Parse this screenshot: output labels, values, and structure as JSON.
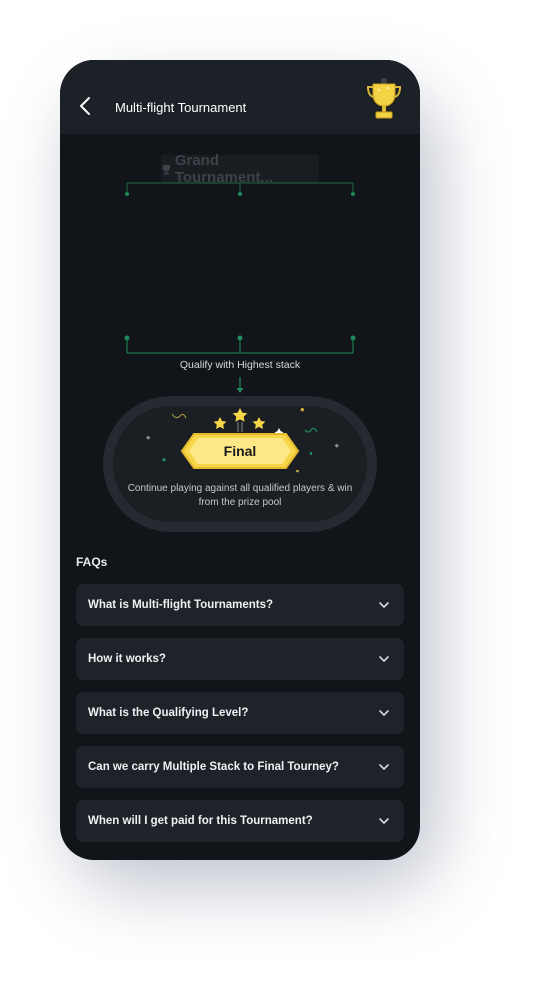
{
  "header": {
    "title": "Multi-flight Tournament",
    "trophy_icon": "trophy-icon",
    "back_icon": "chevron-left-icon"
  },
  "bracket": {
    "top_label": "Grand Tournament..."
  },
  "qualify": {
    "text": "Qualify with Highest stack"
  },
  "final": {
    "badge": "Final",
    "description": "Continue playing against all qualified players & win from the prize pool"
  },
  "faqs": {
    "heading": "FAQs",
    "items": [
      {
        "question": "What is Multi-flight Tournaments?"
      },
      {
        "question": "How it works?"
      },
      {
        "question": "What is the Qualifying Level?"
      },
      {
        "question": "Can we carry Multiple Stack to Final Tourney?"
      },
      {
        "question": "When will I get paid for this Tournament?"
      }
    ]
  },
  "colors": {
    "background": "#111418",
    "accent_green": "#1f8a5a",
    "gold": "#f7d548"
  }
}
